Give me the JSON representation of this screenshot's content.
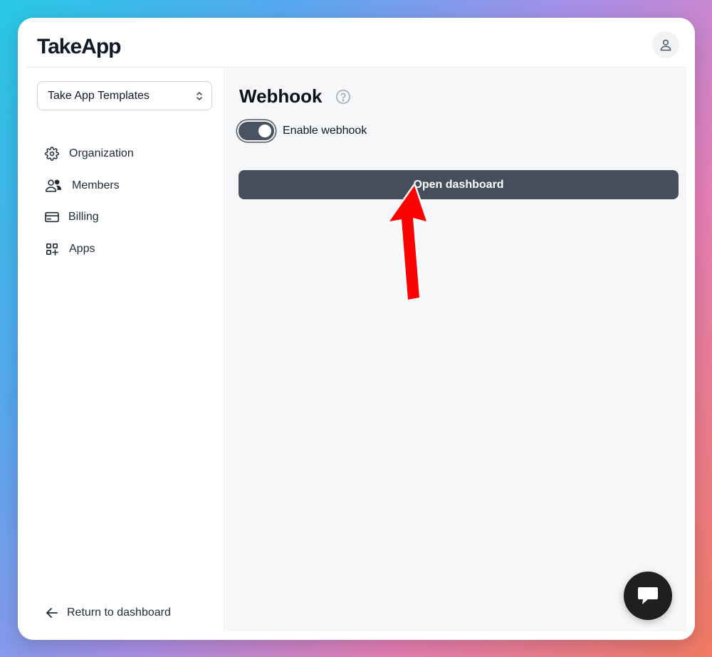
{
  "app": {
    "logo_text": "TakeApp"
  },
  "header": {
    "user_icon": "user-icon"
  },
  "sidebar": {
    "org_select": {
      "value": "Take App Templates",
      "icon": "chevron-up-down-icon"
    },
    "items": [
      {
        "label": "Organization",
        "icon": "gear-icon"
      },
      {
        "label": "Members",
        "icon": "users-icon"
      },
      {
        "label": "Billing",
        "icon": "credit-card-icon"
      },
      {
        "label": "Apps",
        "icon": "apps-grid-icon"
      }
    ],
    "return_label": "Return to dashboard",
    "return_icon": "arrow-left-icon"
  },
  "main": {
    "title": "Webhook",
    "help_icon": "question-circle-icon",
    "toggle": {
      "label": "Enable webhook",
      "enabled": true
    },
    "open_button_label": "Open dashboard",
    "annotation_arrow_color": "#ff0000"
  },
  "chat": {
    "icon": "chat-bubble-icon"
  },
  "colors": {
    "button_dark": "#454f5c",
    "chat_button": "#1f1f1f"
  }
}
